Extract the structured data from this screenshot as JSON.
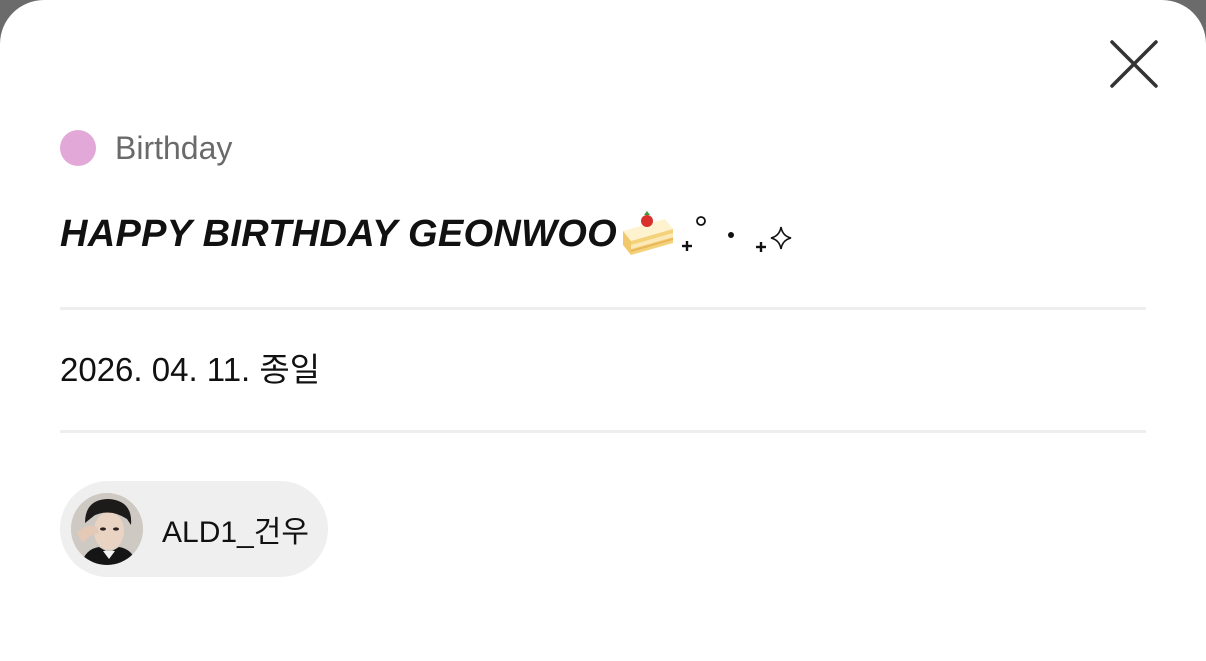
{
  "modal": {
    "close_icon": "close-icon",
    "category": {
      "label": "Birthday",
      "color": "#e2a8d8"
    },
    "title": "HAPPY BIRTHDAY GEONWOO",
    "title_decoration_icons": [
      "cake-icon",
      "sparkle-icon"
    ],
    "date": "2026. 04. 11. 종일",
    "member": {
      "name": "ALD1_건우",
      "avatar_icon": "avatar"
    }
  }
}
